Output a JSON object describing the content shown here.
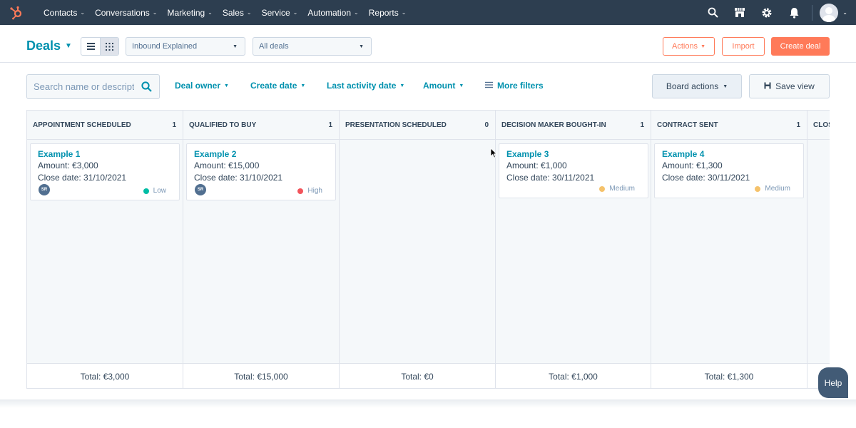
{
  "nav": {
    "items": [
      "Contacts",
      "Conversations",
      "Marketing",
      "Sales",
      "Service",
      "Automation",
      "Reports"
    ]
  },
  "header": {
    "title": "Deals",
    "pipeline_select": "Inbound Explained",
    "view_select": "All deals",
    "actions_label": "Actions",
    "import_label": "Import",
    "create_label": "Create deal"
  },
  "filters": {
    "search_placeholder": "Search name or description",
    "deal_owner": "Deal owner",
    "create_date": "Create date",
    "last_activity": "Last activity date",
    "amount": "Amount",
    "more_filters": "More filters",
    "board_actions": "Board actions",
    "save_view": "Save view"
  },
  "columns": [
    {
      "title": "APPOINTMENT SCHEDULED",
      "count": "1",
      "total": "Total: €3,000",
      "cards": [
        {
          "name": "Example 1",
          "amount": "Amount: €3,000",
          "close": "Close date: 31/10/2021",
          "owner": "SR",
          "priority": "Low",
          "priority_color": "#00bda5"
        }
      ]
    },
    {
      "title": "QUALIFIED TO BUY",
      "count": "1",
      "total": "Total: €15,000",
      "cards": [
        {
          "name": "Example 2",
          "amount": "Amount: €15,000",
          "close": "Close date: 31/10/2021",
          "owner": "SR",
          "priority": "High",
          "priority_color": "#f2545b"
        }
      ]
    },
    {
      "title": "PRESENTATION SCHEDULED",
      "count": "0",
      "total": "Total: €0",
      "cards": []
    },
    {
      "title": "DECISION MAKER BOUGHT-IN",
      "count": "1",
      "total": "Total: €1,000",
      "cards": [
        {
          "name": "Example 3",
          "amount": "Amount: €1,000",
          "close": "Close date: 30/11/2021",
          "owner": "",
          "priority": "Medium",
          "priority_color": "#f5c26b"
        }
      ]
    },
    {
      "title": "CONTRACT SENT",
      "count": "1",
      "total": "Total: €1,300",
      "cards": [
        {
          "name": "Example 4",
          "amount": "Amount: €1,300",
          "close": "Close date: 30/11/2021",
          "owner": "",
          "priority": "Medium",
          "priority_color": "#f5c26b"
        }
      ]
    },
    {
      "title": "CLOS",
      "count": "",
      "total": "",
      "cards": []
    }
  ],
  "help_label": "Help"
}
